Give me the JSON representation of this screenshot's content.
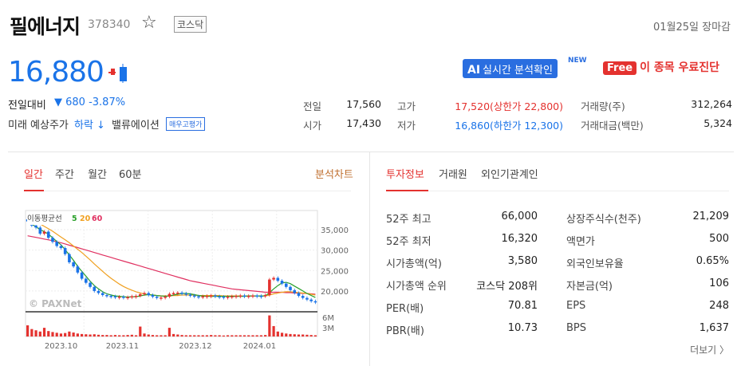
{
  "stock": {
    "name": "필에너지",
    "code": "378340",
    "market": "코스닥",
    "close_time": "01월25일 장마감",
    "price": "16,880",
    "change_label": "전일대비",
    "change_value": "▼ 680 -3.87%",
    "future_label": "미래 예상주가",
    "future_value": "하락 ↓",
    "valuation_label": "밸류에이션",
    "valuation_badge": "매우고평가"
  },
  "promo": {
    "ai_prefix": "AI",
    "ai_label": "실시간 분석확인",
    "new_badge": "NEW",
    "free_badge": "Free",
    "free_label": "이 종목 우료진단"
  },
  "quote": {
    "prev_close_label": "전일",
    "prev_close": "17,560",
    "open_label": "시가",
    "open": "17,430",
    "high_label": "고가",
    "high": "17,520(상한가 22,800)",
    "low_label": "저가",
    "low": "16,860(하한가 12,300)",
    "volume_label": "거래량(주)",
    "volume": "312,264",
    "amount_label": "거래대금(백만)",
    "amount": "5,324"
  },
  "chart_tabs": [
    "일간",
    "주간",
    "월간",
    "60분"
  ],
  "chart_link": "분석차트",
  "info_tabs": [
    "투자정보",
    "거래원",
    "외인기관계인"
  ],
  "investment": {
    "left": [
      {
        "label": "52주 최고",
        "value": "66,000"
      },
      {
        "label": "52주 최저",
        "value": "16,320"
      },
      {
        "label": "시가총액(억)",
        "value": "3,580"
      },
      {
        "label": "시가총액 순위",
        "value": "코스닥 208위"
      },
      {
        "label": "PER(배)",
        "value": "70.81"
      },
      {
        "label": "PBR(배)",
        "value": "10.73"
      }
    ],
    "right": [
      {
        "label": "상장주식수(천주)",
        "value": "21,209"
      },
      {
        "label": "액면가",
        "value": "500"
      },
      {
        "label": "외국인보유율",
        "value": "0.65%"
      },
      {
        "label": "자본금(억)",
        "value": "106"
      },
      {
        "label": "EPS",
        "value": "248"
      },
      {
        "label": "BPS",
        "value": "1,637"
      }
    ]
  },
  "more_label": "더보기 〉",
  "chart_data": {
    "type": "line",
    "legend_title": "이동평균선",
    "ma_labels": [
      "5",
      "20",
      "60"
    ],
    "ma_colors": [
      "#2aa02a",
      "#f0a020",
      "#e03060"
    ],
    "y_ticks": [
      "35,000",
      "30,000",
      "25,000",
      "20,000"
    ],
    "y_tick_values": [
      35000,
      30000,
      25000,
      20000
    ],
    "vol_ticks": [
      "6M",
      "3M"
    ],
    "x_ticks": [
      "2023.10",
      "2023.11",
      "2023.12",
      "2024.01"
    ],
    "watermark": "© PAXNet",
    "ylim": [
      15500,
      38500
    ],
    "price": [
      37000,
      36000,
      35500,
      34000,
      34500,
      33000,
      32000,
      31000,
      30500,
      29000,
      27000,
      26000,
      24500,
      23000,
      22000,
      21000,
      20000,
      19500,
      19000,
      18800,
      18700,
      18500,
      18600,
      18400,
      18500,
      18700,
      18800,
      19200,
      19500,
      19000,
      18600,
      18300,
      18400,
      18600,
      19300,
      19500,
      19600,
      19400,
      19100,
      18900,
      18700,
      18600,
      18700,
      18800,
      18900,
      18700,
      18600,
      18500,
      18600,
      18700,
      18800,
      18900,
      18700,
      18800,
      18900,
      18800,
      18700,
      19000,
      22800,
      23200,
      22500,
      21800,
      21000,
      20200,
      19500,
      18800,
      18300,
      17900,
      17500,
      17200
    ],
    "ma5": [
      37000,
      36300,
      35700,
      35000,
      34500,
      33900,
      33000,
      32100,
      31300,
      30100,
      28800,
      27500,
      26000,
      24800,
      23600,
      22400,
      21300,
      20500,
      19800,
      19300,
      19000,
      18800,
      18700,
      18600,
      18500,
      18600,
      18600,
      18800,
      19000,
      19100,
      19000,
      18900,
      18800,
      18700,
      18800,
      19000,
      19200,
      19400,
      19400,
      19300,
      19100,
      18900,
      18800,
      18700,
      18700,
      18700,
      18700,
      18700,
      18700,
      18700,
      18700,
      18700,
      18700,
      18800,
      18800,
      18800,
      18800,
      18800,
      19600,
      20500,
      21300,
      22000,
      22100,
      21800,
      21200,
      20600,
      20000,
      19400,
      18900,
      18400
    ],
    "ma20": [
      38000,
      37500,
      37000,
      36400,
      35800,
      35200,
      34600,
      33900,
      33200,
      32500,
      31800,
      31000,
      30200,
      29400,
      28500,
      27600,
      26600,
      25700,
      24800,
      23900,
      23100,
      22400,
      21700,
      21100,
      20600,
      20200,
      19800,
      19500,
      19300,
      19100,
      19000,
      18900,
      18800,
      18800,
      18800,
      18900,
      18900,
      19000,
      19000,
      19000,
      19000,
      18900,
      18900,
      18900,
      18900,
      18900,
      18900,
      18800,
      18800,
      18800,
      18800,
      18800,
      18800,
      18800,
      18800,
      18800,
      18800,
      18800,
      19000,
      19300,
      19500,
      19700,
      19800,
      19800,
      19700,
      19600,
      19500,
      19400,
      19200,
      19000
    ],
    "ma60": [
      33500,
      33300,
      33100,
      32900,
      32700,
      32500,
      32300,
      32000,
      31800,
      31500,
      31200,
      30900,
      30600,
      30300,
      30000,
      29700,
      29400,
      29100,
      28800,
      28500,
      28200,
      27900,
      27600,
      27300,
      27000,
      26700,
      26400,
      26100,
      25800,
      25500,
      25200,
      24900,
      24600,
      24300,
      24000,
      23700,
      23400,
      23100,
      22800,
      22500,
      22300,
      22100,
      21900,
      21700,
      21500,
      21300,
      21100,
      20900,
      20700,
      20500,
      20400,
      20300,
      20200,
      20100,
      20000,
      19900,
      19800,
      19700,
      19700,
      19700,
      19700,
      19700,
      19600,
      19600,
      19500,
      19500,
      19400,
      19400,
      19300,
      19200
    ],
    "volume": [
      4.5,
      3.0,
      2.5,
      2.0,
      3.5,
      2.2,
      1.8,
      1.5,
      1.2,
      1.4,
      2.0,
      1.6,
      1.2,
      1.0,
      0.9,
      0.8,
      0.9,
      0.7,
      0.6,
      0.6,
      0.5,
      0.6,
      0.5,
      0.5,
      0.6,
      0.7,
      0.5,
      4.0,
      1.2,
      0.8,
      0.6,
      0.5,
      0.5,
      0.5,
      3.5,
      1.0,
      0.8,
      0.6,
      0.5,
      0.5,
      0.5,
      0.5,
      0.5,
      0.5,
      0.6,
      0.5,
      0.5,
      0.4,
      0.5,
      0.5,
      0.5,
      0.5,
      0.5,
      0.5,
      0.5,
      0.5,
      0.5,
      0.6,
      8.5,
      4.2,
      2.0,
      1.5,
      1.2,
      1.0,
      0.9,
      0.8,
      0.8,
      0.7,
      0.6,
      0.5
    ]
  }
}
